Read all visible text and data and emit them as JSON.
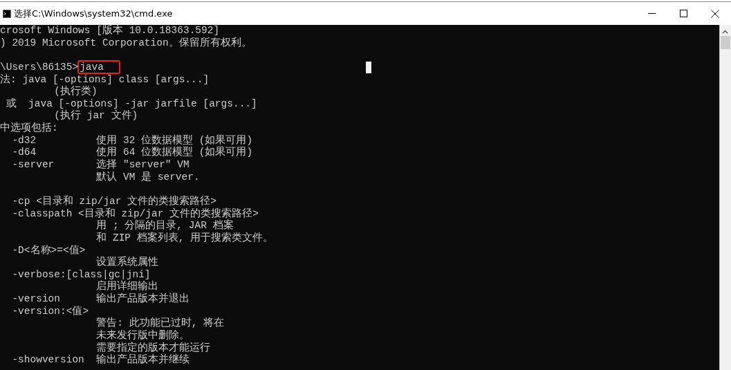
{
  "window": {
    "title": "选择C:\\Windows\\system32\\cmd.exe"
  },
  "console": {
    "lines": [
      {
        "kind": "text",
        "text": "crosoft Windows [版本 10.0.18363.592]"
      },
      {
        "kind": "text",
        "text": ") 2019 Microsoft Corporation。保留所有权利。"
      },
      {
        "kind": "blank"
      },
      {
        "kind": "input",
        "prompt": "\\Users\\86135>",
        "command": "java",
        "highlighted": true
      },
      {
        "kind": "text",
        "text": "法: java [-options] class [args...]"
      },
      {
        "kind": "text",
        "text": "         (执行类)"
      },
      {
        "kind": "text",
        "text": " 或  java [-options] -jar jarfile [args...]"
      },
      {
        "kind": "text",
        "text": "         (执行 jar 文件)"
      },
      {
        "kind": "text",
        "text": "中选项包括:"
      },
      {
        "kind": "text",
        "text": "  -d32          使用 32 位数据模型 (如果可用)"
      },
      {
        "kind": "text",
        "text": "  -d64          使用 64 位数据模型 (如果可用)"
      },
      {
        "kind": "text",
        "text": "  -server       选择 \"server\" VM"
      },
      {
        "kind": "text",
        "text": "                默认 VM 是 server."
      },
      {
        "kind": "blank"
      },
      {
        "kind": "text",
        "text": "  -cp <目录和 zip/jar 文件的类搜索路径>"
      },
      {
        "kind": "text",
        "text": "  -classpath <目录和 zip/jar 文件的类搜索路径>"
      },
      {
        "kind": "text",
        "text": "                用 ; 分隔的目录, JAR 档案"
      },
      {
        "kind": "text",
        "text": "                和 ZIP 档案列表, 用于搜索类文件。"
      },
      {
        "kind": "text",
        "text": "  -D<名称>=<值>"
      },
      {
        "kind": "text",
        "text": "                设置系统属性"
      },
      {
        "kind": "text",
        "text": "  -verbose:[class|gc|jni]"
      },
      {
        "kind": "text",
        "text": "                启用详细输出"
      },
      {
        "kind": "text",
        "text": "  -version      输出产品版本并退出"
      },
      {
        "kind": "text",
        "text": "  -version:<值>"
      },
      {
        "kind": "text",
        "text": "                警告: 此功能已过时, 将在"
      },
      {
        "kind": "text",
        "text": "                未来发行版中删除。"
      },
      {
        "kind": "text",
        "text": "                需要指定的版本才能运行"
      },
      {
        "kind": "text",
        "text": "  -showversion  输出产品版本并继续"
      }
    ]
  }
}
